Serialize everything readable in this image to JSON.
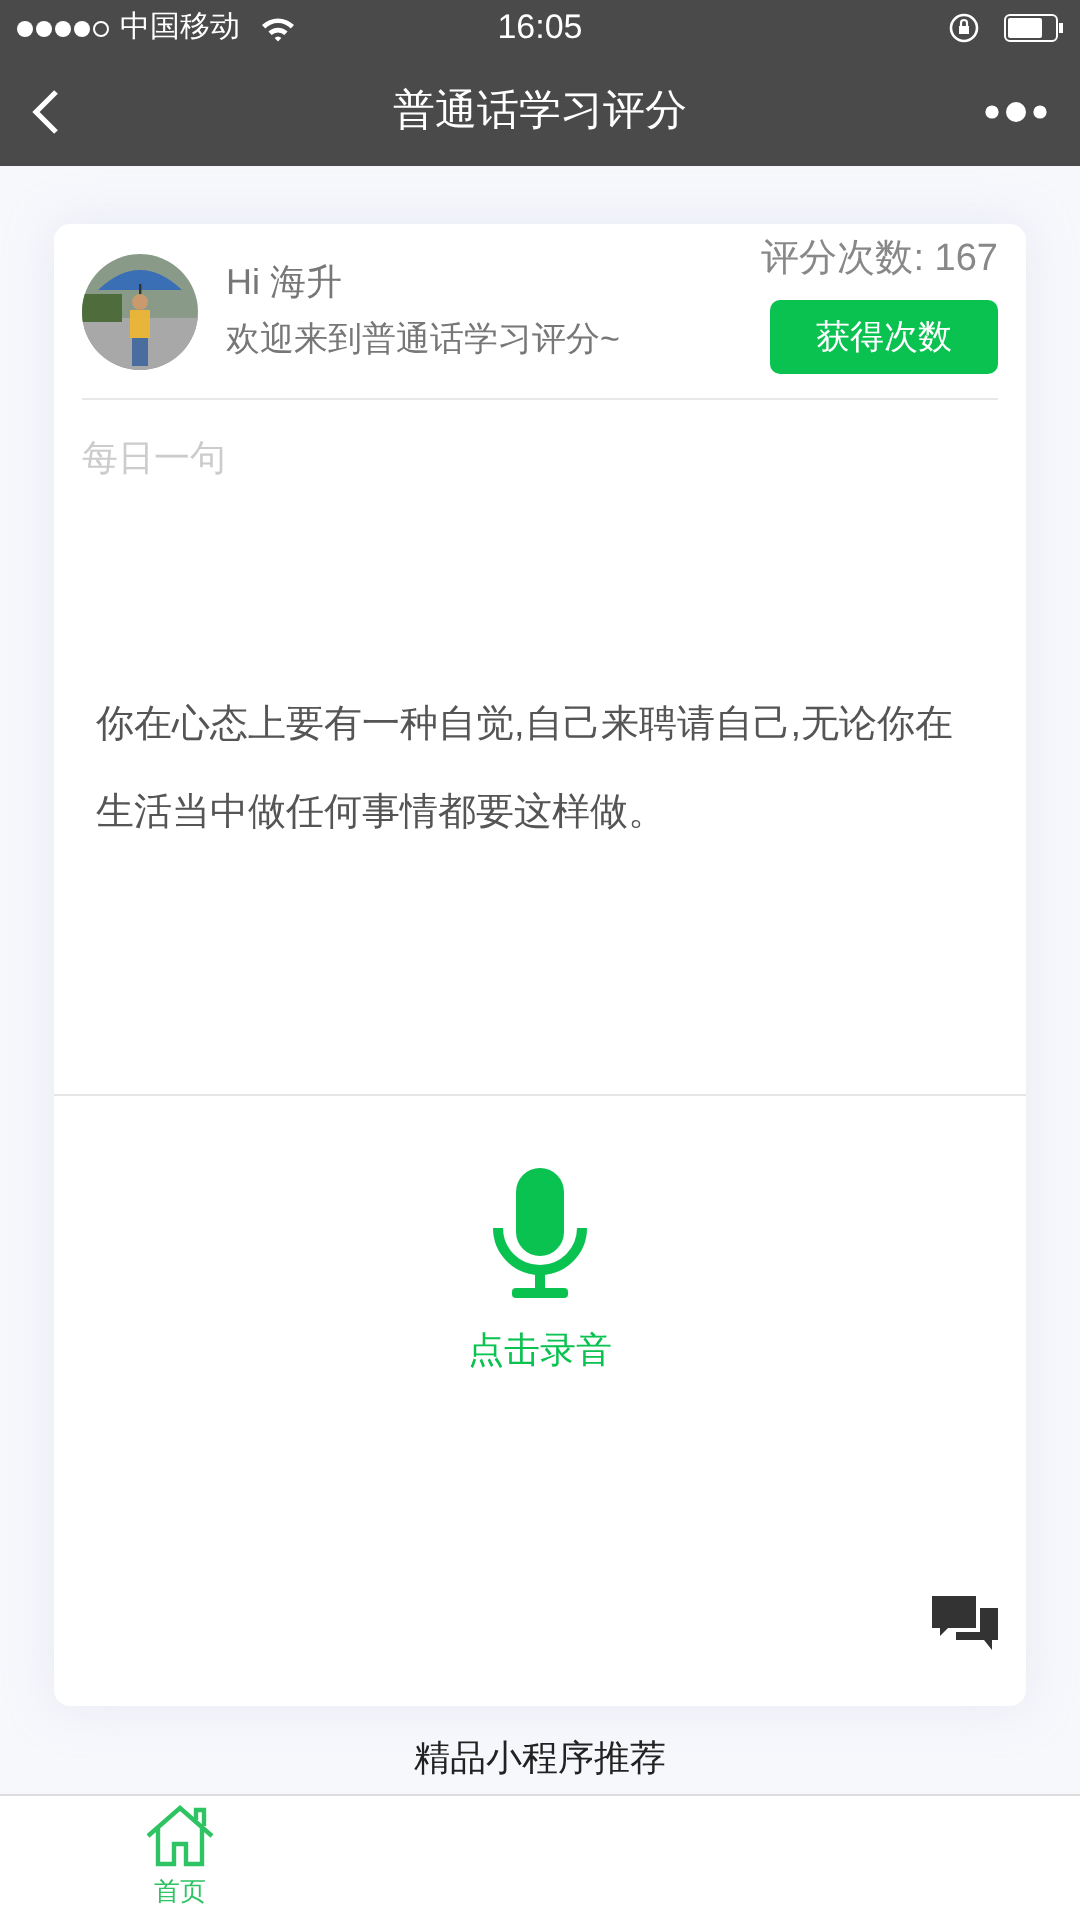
{
  "status_bar": {
    "carrier": "中国移动",
    "time": "16:05"
  },
  "nav_bar": {
    "title": "普通话学习评分"
  },
  "profile": {
    "greeting": "Hi 海升",
    "welcome": "欢迎来到普通话学习评分~",
    "score_count": "评分次数: 167",
    "get_button": "获得次数"
  },
  "daily": {
    "heading": "每日一句",
    "sentence": "你在心态上要有一种自觉,自己来聘请自己,无论你在生活当中做任何事情都要这样做。"
  },
  "record": {
    "label": "点击录音"
  },
  "section_title": "精品小程序推荐",
  "tab_bar": [
    {
      "label": "首页",
      "selected": true
    }
  ]
}
